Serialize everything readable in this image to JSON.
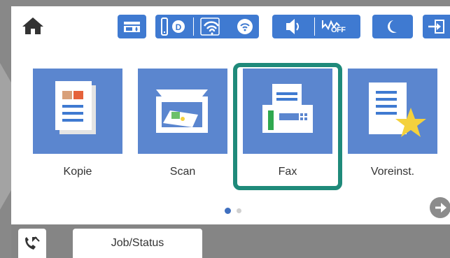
{
  "topbar": {
    "icons": [
      "home-icon",
      "ink-levels-icon",
      "wifi-direct-icon",
      "wifi-icon",
      "sound-icon",
      "eco-off-icon",
      "sleep-mode-icon",
      "logout-icon"
    ],
    "eco_label": "OFF"
  },
  "tiles": [
    {
      "label": "Kopie",
      "icon": "copy-icon"
    },
    {
      "label": "Scan",
      "icon": "scan-icon"
    },
    {
      "label": "Fax",
      "icon": "fax-icon",
      "selected": true
    },
    {
      "label": "Voreinst.",
      "icon": "presets-icon"
    }
  ],
  "pager": {
    "current": 1,
    "total": 2
  },
  "bottombar": {
    "job_status_label": "Job/Status"
  },
  "colors": {
    "accent_blue": "#3f7ad1",
    "tile_blue": "#5b86cf",
    "highlight": "#1f8a7a",
    "bezel": "#888888"
  }
}
